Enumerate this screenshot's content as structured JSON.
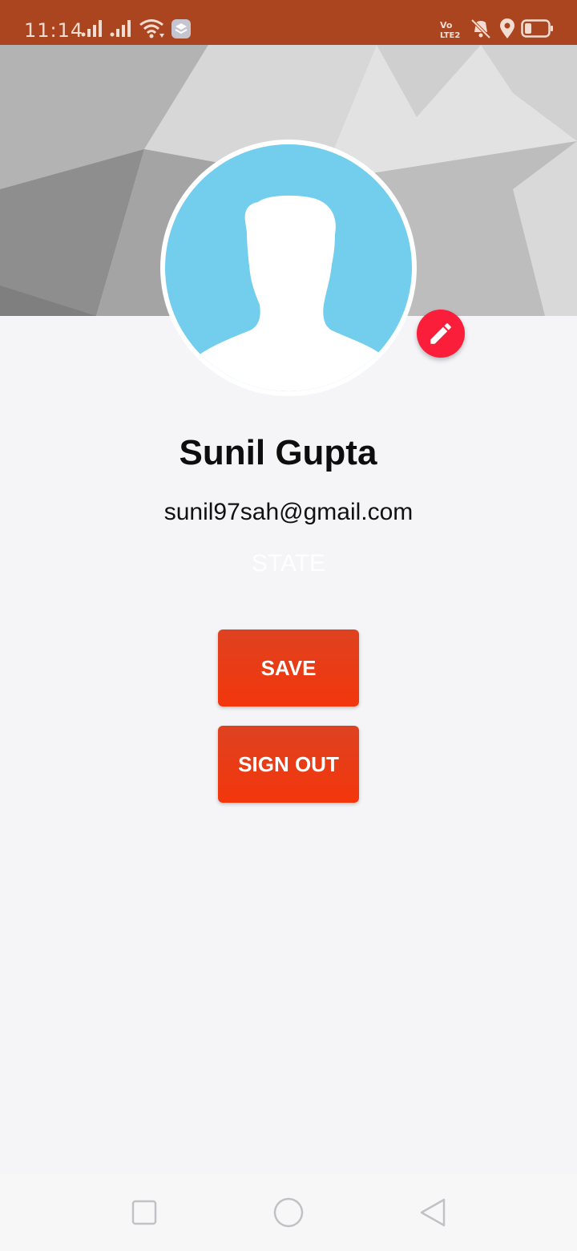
{
  "status_bar": {
    "time": "11:14",
    "left_icons": [
      "signal-1-icon",
      "signal-2-icon",
      "wifi-icon",
      "app-notification-icon"
    ],
    "right_icons": [
      "volte-icon",
      "vibrate-icon",
      "location-icon",
      "battery-icon"
    ],
    "volte_label": "Vo LTE",
    "background_color": "#ab451f"
  },
  "profile": {
    "name": "Sunil Gupta",
    "email": "sunil97sah@gmail.com",
    "state": "STATE",
    "avatar_color": "#73cded",
    "edit_icon": "pencil-icon",
    "edit_button_color": "#fb1e3a"
  },
  "actions": {
    "save_label": "SAVE",
    "sign_out_label": "SIGN OUT",
    "button_color": "#ef3a12"
  },
  "nav_bar": {
    "buttons": [
      "recents-icon",
      "home-icon",
      "back-icon"
    ]
  }
}
